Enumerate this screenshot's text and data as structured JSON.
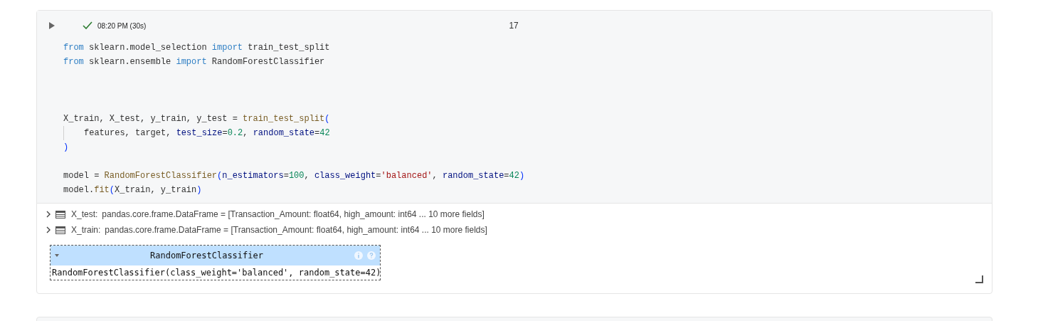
{
  "cell": {
    "status": {
      "ok": true,
      "time": "08:20 PM (30s)"
    },
    "execution_count": "17",
    "code_lines": [
      {
        "kind": "code",
        "indent": false,
        "tokens": [
          {
            "t": "from",
            "kind": "kw"
          },
          {
            "t": " sklearn.model_selection ",
            "kind": "plain"
          },
          {
            "t": "import",
            "kind": "kw"
          },
          {
            "t": " train_test_split",
            "kind": "plain"
          }
        ]
      },
      {
        "kind": "code",
        "indent": false,
        "tokens": [
          {
            "t": "from",
            "kind": "kw"
          },
          {
            "t": " sklearn.ensemble ",
            "kind": "plain"
          },
          {
            "t": "import",
            "kind": "kw"
          },
          {
            "t": " RandomForestClassifier",
            "kind": "plain"
          }
        ]
      },
      {
        "kind": "blank"
      },
      {
        "kind": "blank"
      },
      {
        "kind": "blank"
      },
      {
        "kind": "code",
        "indent": false,
        "tokens": [
          {
            "t": "X_train, X_test, y_train, y_test = ",
            "kind": "plain"
          },
          {
            "t": "train_test_split",
            "kind": "fn"
          },
          {
            "t": "(",
            "kind": "paren"
          }
        ]
      },
      {
        "kind": "code",
        "indent": true,
        "tokens": [
          {
            "t": "features, target, ",
            "kind": "plain"
          },
          {
            "t": "test_size",
            "kind": "param"
          },
          {
            "t": "=",
            "kind": "plain"
          },
          {
            "t": "0.2",
            "kind": "num"
          },
          {
            "t": ", ",
            "kind": "plain"
          },
          {
            "t": "random_state",
            "kind": "param"
          },
          {
            "t": "=",
            "kind": "plain"
          },
          {
            "t": "42",
            "kind": "num"
          }
        ]
      },
      {
        "kind": "code",
        "indent": false,
        "tokens": [
          {
            "t": ")",
            "kind": "paren"
          }
        ]
      },
      {
        "kind": "blank"
      },
      {
        "kind": "code",
        "indent": false,
        "tokens": [
          {
            "t": "model = ",
            "kind": "plain"
          },
          {
            "t": "RandomForestClassifier",
            "kind": "fn"
          },
          {
            "t": "(",
            "kind": "paren"
          },
          {
            "t": "n_estimators",
            "kind": "param"
          },
          {
            "t": "=",
            "kind": "plain"
          },
          {
            "t": "100",
            "kind": "num"
          },
          {
            "t": ", ",
            "kind": "plain"
          },
          {
            "t": "class_weight",
            "kind": "param"
          },
          {
            "t": "=",
            "kind": "plain"
          },
          {
            "t": "'balanced'",
            "kind": "str"
          },
          {
            "t": ", ",
            "kind": "plain"
          },
          {
            "t": "random_state",
            "kind": "param"
          },
          {
            "t": "=",
            "kind": "plain"
          },
          {
            "t": "42",
            "kind": "num"
          },
          {
            "t": ")",
            "kind": "paren"
          }
        ]
      },
      {
        "kind": "code",
        "indent": false,
        "tokens": [
          {
            "t": "model.",
            "kind": "plain"
          },
          {
            "t": "fit",
            "kind": "fn"
          },
          {
            "t": "(",
            "kind": "paren"
          },
          {
            "t": "X_train, y_train",
            "kind": "plain"
          },
          {
            "t": ")",
            "kind": "paren"
          }
        ]
      }
    ],
    "variables": [
      {
        "name": "X_test:",
        "value": "pandas.core.frame.DataFrame = [Transaction_Amount: float64, high_amount: int64 ... 10 more fields]",
        "expanded": false
      },
      {
        "name": "X_train:",
        "value": "pandas.core.frame.DataFrame = [Transaction_Amount: float64, high_amount: int64 ... 10 more fields]",
        "expanded": false
      }
    ],
    "estimator": {
      "title": "RandomForestClassifier",
      "expanded": true,
      "repr": "RandomForestClassifier(class_weight='balanced', random_state=42)"
    }
  }
}
